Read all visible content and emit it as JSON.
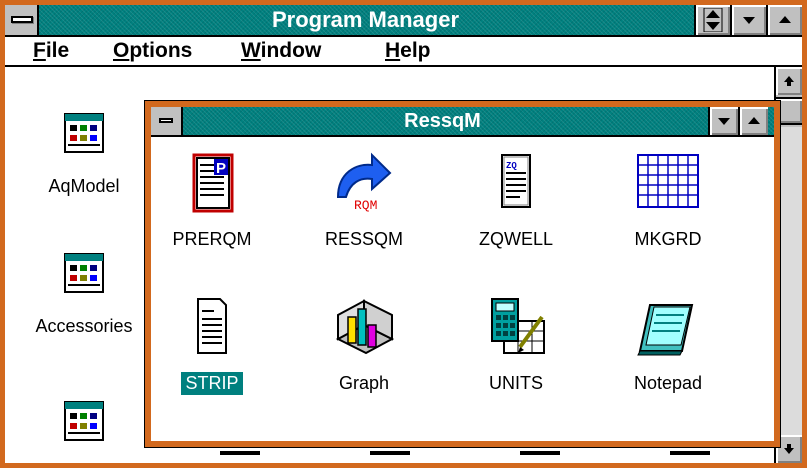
{
  "window": {
    "title": "Program Manager"
  },
  "menu": {
    "items": [
      {
        "acc": "F",
        "rest": "ile"
      },
      {
        "acc": "O",
        "rest": "ptions"
      },
      {
        "acc": "W",
        "rest": "indow"
      },
      {
        "acc": "H",
        "rest": "elp"
      }
    ]
  },
  "groups": [
    {
      "label": "AqModel",
      "icon": "program-group-icon"
    },
    {
      "label": "Accessories",
      "icon": "program-group-icon"
    },
    {
      "label": "",
      "icon": "program-group-icon"
    }
  ],
  "child_window": {
    "title": "RessqM",
    "programs": [
      {
        "label": "PRERQM",
        "icon": "prerqm-document-icon",
        "selected": false
      },
      {
        "label": "RESSQM",
        "icon": "ressqm-arrow-icon",
        "icon_text": "RQM",
        "selected": false
      },
      {
        "label": "ZQWELL",
        "icon": "zqwell-document-icon",
        "icon_text": "ZQ",
        "selected": false
      },
      {
        "label": "MKGRD",
        "icon": "grid-icon",
        "selected": false
      },
      {
        "label": "STRIP",
        "icon": "text-document-icon",
        "selected": true
      },
      {
        "label": "Graph",
        "icon": "bar-graph-icon",
        "selected": false
      },
      {
        "label": "UNITS",
        "icon": "calculator-icon",
        "selected": false
      },
      {
        "label": "Notepad",
        "icon": "notepad-icon",
        "selected": false
      }
    ]
  },
  "colors": {
    "title_bar": "#00807f",
    "frame": "#d2691e",
    "selection": "#00807f"
  }
}
